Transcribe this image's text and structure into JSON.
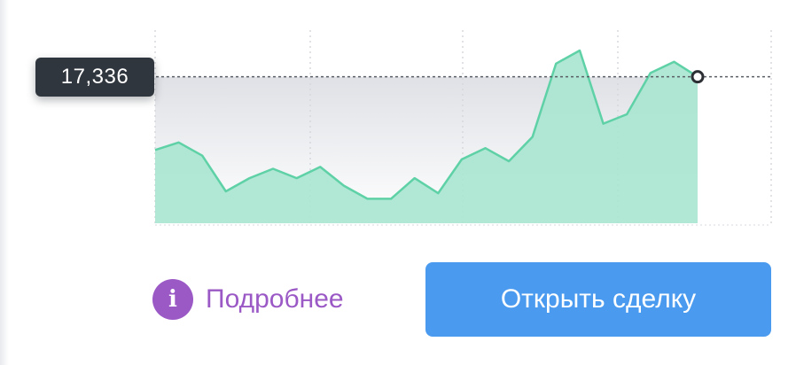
{
  "chart_data": {
    "type": "area",
    "current_value_label": "17,336",
    "series_color": "#5fd1a7",
    "area_fill": "#a8e6d0",
    "points": [
      0.39,
      0.43,
      0.36,
      0.17,
      0.24,
      0.29,
      0.24,
      0.3,
      0.2,
      0.13,
      0.13,
      0.24,
      0.16,
      0.34,
      0.4,
      0.33,
      0.46,
      0.85,
      0.92,
      0.53,
      0.58,
      0.8,
      0.86,
      0.78
    ]
  },
  "actions": {
    "details_label": "Подробнее",
    "details_icon": "info-icon",
    "open_deal_label": "Открыть сделку",
    "accent_purple": "#9b59c6",
    "accent_blue": "#4a9bf0"
  }
}
